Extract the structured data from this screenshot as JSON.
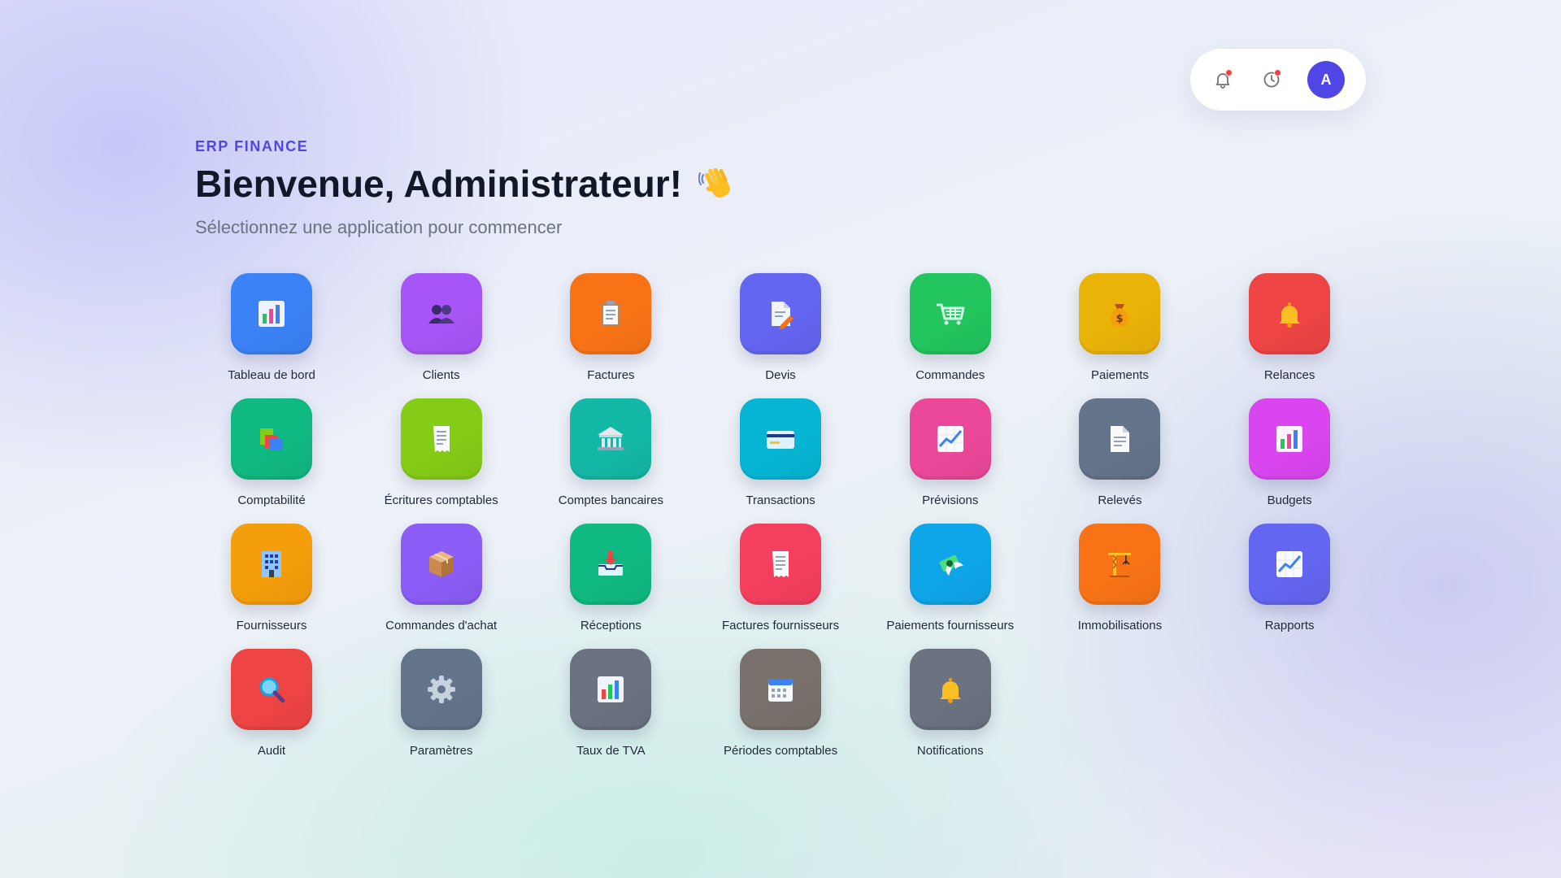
{
  "header": {
    "eyebrow": "ERP FINANCE",
    "title": "Bienvenue, Administrateur!",
    "title_emoji": "waving-hand-icon",
    "subtitle": "Sélectionnez une application pour commencer"
  },
  "toolbar": {
    "notifications_icon": "bell-icon",
    "history_icon": "history-icon",
    "badge_color": "#ef4444",
    "avatar_initial": "A",
    "avatar_color": "#4f46e5"
  },
  "apps": [
    {
      "label": "Tableau de bord",
      "icon": "bar-chart-icon",
      "color": "#3b82f6"
    },
    {
      "label": "Clients",
      "icon": "users-icon",
      "color": "#a855f7"
    },
    {
      "label": "Factures",
      "icon": "clipboard-icon",
      "color": "#f97316"
    },
    {
      "label": "Devis",
      "icon": "document-pencil-icon",
      "color": "#6366f1"
    },
    {
      "label": "Commandes",
      "icon": "shopping-cart-icon",
      "color": "#22c55e"
    },
    {
      "label": "Paiements",
      "icon": "money-bag-icon",
      "color": "#eab308"
    },
    {
      "label": "Relances",
      "icon": "bell-icon",
      "color": "#ef4444"
    },
    {
      "label": "Comptabilité",
      "icon": "books-icon",
      "color": "#10b981"
    },
    {
      "label": "Écritures comptables",
      "icon": "receipt-icon",
      "color": "#84cc16"
    },
    {
      "label": "Comptes bancaires",
      "icon": "bank-icon",
      "color": "#14b8a6"
    },
    {
      "label": "Transactions",
      "icon": "credit-card-icon",
      "color": "#06b6d4"
    },
    {
      "label": "Prévisions",
      "icon": "trend-up-icon",
      "color": "#ec4899"
    },
    {
      "label": "Relevés",
      "icon": "document-icon",
      "color": "#64748b"
    },
    {
      "label": "Budgets",
      "icon": "bar-chart-icon",
      "color": "#d946ef"
    },
    {
      "label": "Fournisseurs",
      "icon": "office-building-icon",
      "color": "#f59e0b"
    },
    {
      "label": "Commandes d'achat",
      "icon": "package-icon",
      "color": "#8b5cf6"
    },
    {
      "label": "Réceptions",
      "icon": "inbox-tray-icon",
      "color": "#10b981"
    },
    {
      "label": "Factures fournisseurs",
      "icon": "receipt-icon",
      "color": "#f43f5e"
    },
    {
      "label": "Paiements fournisseurs",
      "icon": "money-wings-icon",
      "color": "#0ea5e9"
    },
    {
      "label": "Immobilisations",
      "icon": "construction-crane-icon",
      "color": "#f97316"
    },
    {
      "label": "Rapports",
      "icon": "trend-up-icon",
      "color": "#6366f1"
    },
    {
      "label": "Audit",
      "icon": "magnifier-icon",
      "color": "#ef4444"
    },
    {
      "label": "Paramètres",
      "icon": "gear-icon",
      "color": "#64748b"
    },
    {
      "label": "Taux de TVA",
      "icon": "bar-chart-icon",
      "color": "#6b7280"
    },
    {
      "label": "Périodes comptables",
      "icon": "calendar-icon",
      "color": "#78716c"
    },
    {
      "label": "Notifications",
      "icon": "bell-icon",
      "color": "#6b7280"
    }
  ]
}
